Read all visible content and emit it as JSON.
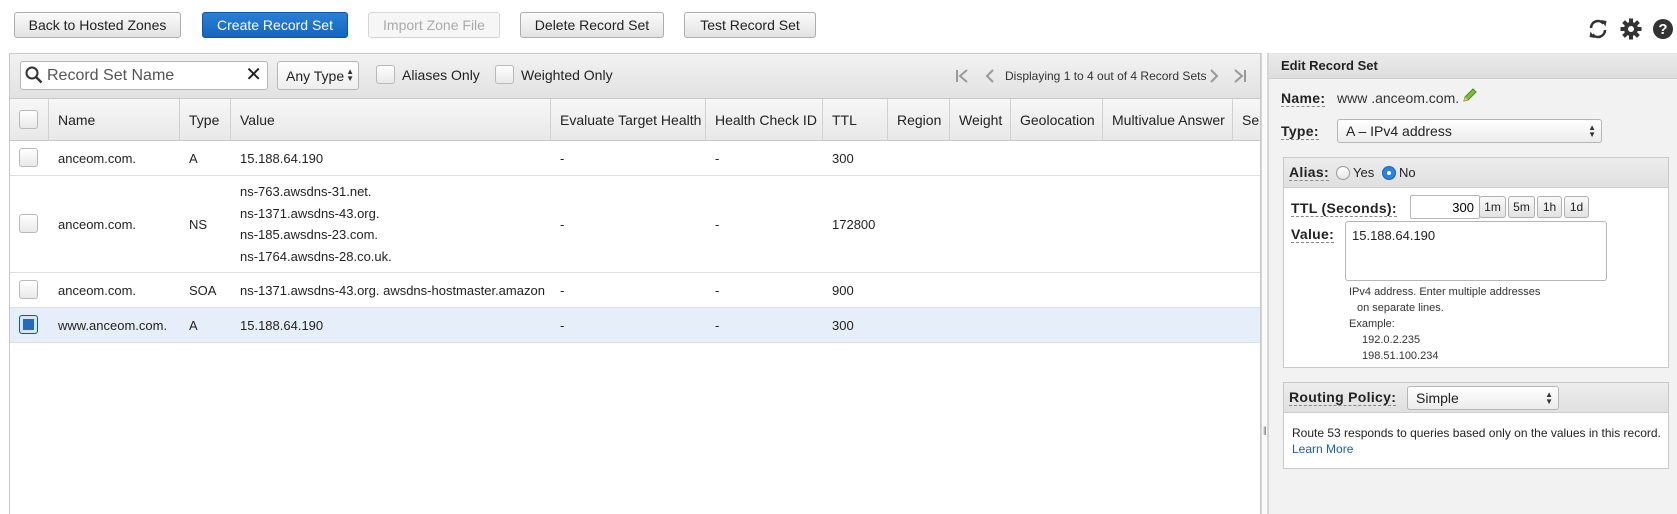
{
  "toolbar": {
    "back_label": "Back to Hosted Zones",
    "create_label": "Create Record Set",
    "import_label": "Import Zone File",
    "delete_label": "Delete Record Set",
    "test_label": "Test Record Set",
    "icons": [
      "refresh-icon",
      "gear-icon",
      "help-icon"
    ]
  },
  "filter": {
    "search_placeholder": "Record Set Name",
    "type_value": "Any Type",
    "aliases_only": "Aliases Only",
    "weighted_only": "Weighted Only",
    "pager_text": "Displaying 1 to 4 out of 4 Record Sets"
  },
  "columns": [
    "Name",
    "Type",
    "Value",
    "Evaluate Target Health",
    "Health Check ID",
    "TTL",
    "Region",
    "Weight",
    "Geolocation",
    "Multivalue Answer",
    "Se"
  ],
  "rows": [
    {
      "name": "anceom.com.",
      "type": "A",
      "values": [
        "15.188.64.190"
      ],
      "eth": "-",
      "hcid": "-",
      "ttl": "300",
      "selected": false
    },
    {
      "name": "anceom.com.",
      "type": "NS",
      "values": [
        "ns-763.awsdns-31.net.",
        "ns-1371.awsdns-43.org.",
        "ns-185.awsdns-23.com.",
        "ns-1764.awsdns-28.co.uk."
      ],
      "eth": "-",
      "hcid": "-",
      "ttl": "172800",
      "selected": false
    },
    {
      "name": "anceom.com.",
      "type": "SOA",
      "values": [
        "ns-1371.awsdns-43.org. awsdns-hostmaster.amazon"
      ],
      "eth": "-",
      "hcid": "-",
      "ttl": "900",
      "selected": false
    },
    {
      "name": "www.anceom.com.",
      "type": "A",
      "values": [
        "15.188.64.190"
      ],
      "eth": "-",
      "hcid": "-",
      "ttl": "300",
      "selected": true
    }
  ],
  "edit": {
    "title": "Edit Record Set",
    "name_label": "Name:",
    "name_value": "www .anceom.com.",
    "type_label": "Type:",
    "type_value": "A – IPv4 address",
    "alias_label": "Alias:",
    "alias_yes": "Yes",
    "alias_no": "No",
    "alias_selected": "No",
    "ttl_label": "TTL (Seconds):",
    "ttl_value": "300",
    "ttl_buttons": [
      "1m",
      "5m",
      "1h",
      "1d"
    ],
    "value_label": "Value:",
    "value_text": "15.188.64.190",
    "hint_line1": "IPv4 address. Enter multiple addresses",
    "hint_line2": "on separate lines.",
    "hint_line3": "Example:",
    "hint_line4": "192.0.2.235",
    "hint_line5": "198.51.100.234",
    "routing_label": "Routing Policy:",
    "routing_value": "Simple",
    "routing_desc": "Route 53 responds to queries based only on the values in this record.",
    "learn_more": "Learn More"
  },
  "colors": {
    "primary": "#1b6ec8",
    "selected_row": "#e6eff9",
    "link": "#1a5eb0"
  }
}
